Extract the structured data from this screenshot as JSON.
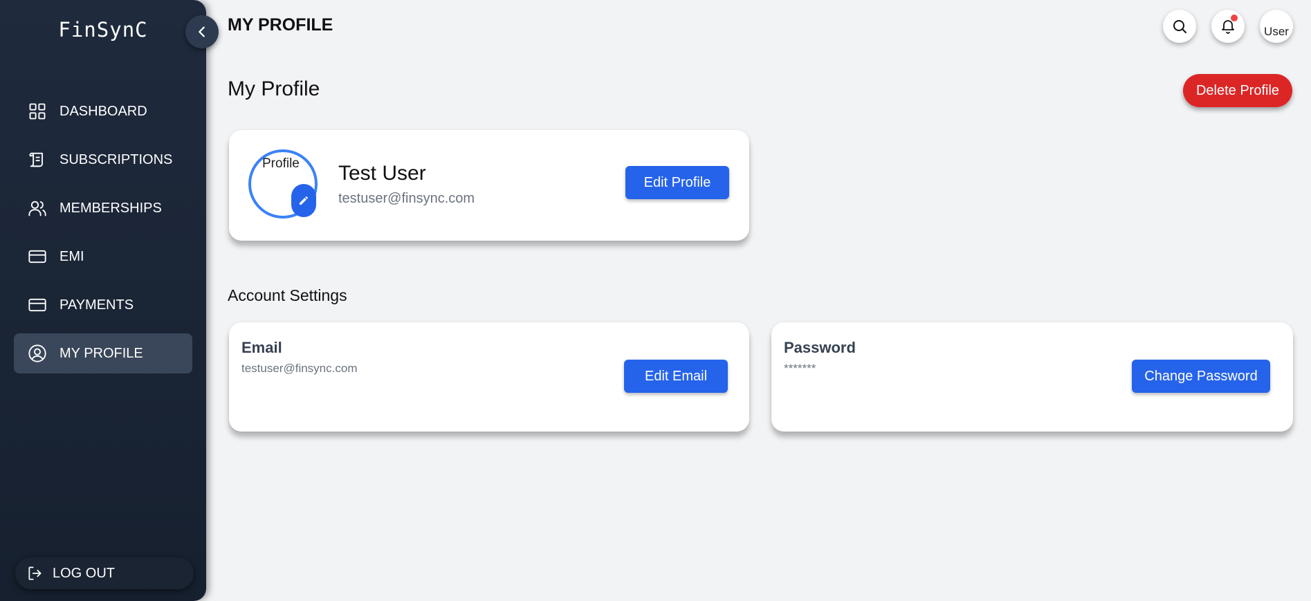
{
  "app": {
    "logo": "FinSynC"
  },
  "sidebar": {
    "items": [
      {
        "label": "DASHBOARD",
        "icon": "grid-icon"
      },
      {
        "label": "SUBSCRIPTIONS",
        "icon": "scroll-icon"
      },
      {
        "label": "MEMBERSHIPS",
        "icon": "users-icon"
      },
      {
        "label": "EMI",
        "icon": "card-icon"
      },
      {
        "label": "PAYMENTS",
        "icon": "card-icon"
      },
      {
        "label": "MY PROFILE",
        "icon": "user-circle-icon",
        "active": true
      }
    ],
    "logout_label": "LOG OUT"
  },
  "header": {
    "title": "MY PROFILE",
    "user_avatar_alt": "User"
  },
  "main": {
    "title": "My Profile",
    "delete_button": "Delete Profile",
    "profile": {
      "avatar_alt": "Profile",
      "name": "Test User",
      "email": "testuser@finsync.com",
      "edit_button": "Edit Profile"
    },
    "account_settings": {
      "title": "Account Settings",
      "email": {
        "label": "Email",
        "value": "testuser@finsync.com",
        "button": "Edit Email"
      },
      "password": {
        "label": "Password",
        "value": "*******",
        "button": "Change Password"
      }
    }
  },
  "colors": {
    "sidebar_bg": "#1f2a3d",
    "primary": "#2563eb",
    "danger": "#dc2626",
    "active_item": "#3a4659",
    "notification": "#ef4444"
  }
}
